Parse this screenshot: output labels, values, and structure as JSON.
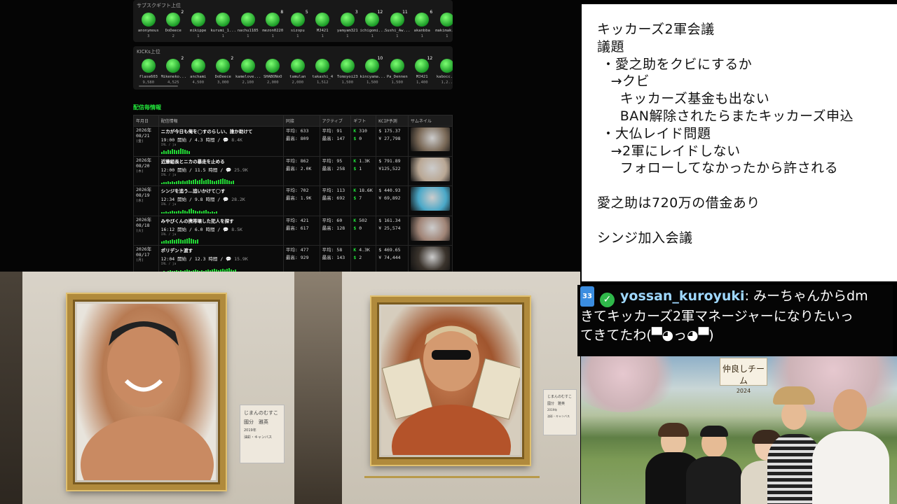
{
  "superchat_top": {
    "title": "サブスクギフト上位",
    "users": [
      {
        "name": "anonymous",
        "count": "3",
        "badge": "0"
      },
      {
        "name": "DoDeece",
        "count": "2",
        "badge": "2"
      },
      {
        "name": "mikippe",
        "count": "1",
        "badge": "0"
      },
      {
        "name": "kurumi_1...",
        "count": "1",
        "badge": "0"
      },
      {
        "name": "nachu1185",
        "count": "1",
        "badge": "0"
      },
      {
        "name": "mezon0220",
        "count": "1",
        "badge": "8"
      },
      {
        "name": "sizopu",
        "count": "1",
        "badge": "5"
      },
      {
        "name": "MJ421",
        "count": "1",
        "badge": "0"
      },
      {
        "name": "yamyam321",
        "count": "1",
        "badge": "3"
      },
      {
        "name": "ichigomi...",
        "count": "1",
        "badge": "12"
      },
      {
        "name": "Sushi_Aw...",
        "count": "1",
        "badge": "11"
      },
      {
        "name": "akanbba",
        "count": "1",
        "badge": "6"
      },
      {
        "name": "makimak...",
        "count": "1",
        "badge": "0"
      }
    ]
  },
  "kicks_top": {
    "title": "KICKs上位",
    "users": [
      {
        "name": "flase603",
        "count": "9,580",
        "badge": "0"
      },
      {
        "name": "Mikeneko...",
        "count": "4,525",
        "badge": "2"
      },
      {
        "name": "anchami",
        "count": "4,500",
        "badge": "0"
      },
      {
        "name": "DoDeece",
        "count": "3,000",
        "badge": "2"
      },
      {
        "name": "kamelove...",
        "count": "2,100",
        "badge": "0"
      },
      {
        "name": "SHABONoO",
        "count": "2,000",
        "badge": "0"
      },
      {
        "name": "tamulan",
        "count": "2,000",
        "badge": "0"
      },
      {
        "name": "takashi_4",
        "count": "1,512",
        "badge": "0"
      },
      {
        "name": "Tomoyoi23",
        "count": "1,500",
        "badge": "0"
      },
      {
        "name": "kincyama...",
        "count": "1,500",
        "badge": "10"
      },
      {
        "name": "Pa_Dennen",
        "count": "1,500",
        "badge": "0"
      },
      {
        "name": "MJ421",
        "count": "1,400",
        "badge": "12"
      },
      {
        "name": "kabocc...",
        "count": "1,2..",
        "badge": "0"
      }
    ]
  },
  "streams": {
    "section_title": "配信毎情報",
    "headers": [
      "年月日",
      "配信情報",
      "同接",
      "アクティブ",
      "ギフト",
      "KCIP予測",
      "サムネイル"
    ],
    "avg_label": "平均:",
    "max_label": "最高:",
    "rows": [
      {
        "year": "2026年",
        "md": "08/21",
        "wd": "(金)",
        "title": "ニカが今日も俺を◯すのらしい、誰か助けて",
        "start": "19:00 開始 / 4.3 時間",
        "chat": "8.4K",
        "sub": "IRL / ja",
        "viewers_avg": "633",
        "viewers_max": "809",
        "active_avg": "91",
        "active_max": "147",
        "gift_k": "310",
        "gift_s": "0",
        "kcip_usd": "$ 175.37",
        "kcip_jpy": "¥ 27,798",
        "thumb_color": "#7b6a58",
        "spark": [
          3,
          5,
          4,
          6,
          5,
          7,
          6,
          5,
          6,
          8,
          7,
          6,
          5,
          4
        ]
      },
      {
        "year": "2026年",
        "md": "08/20",
        "wd": "(木)",
        "title": "近藤組長とニカの暴走を止める",
        "start": "12:00 開始 / 11.5 時間",
        "chat": "25.9K",
        "sub": "IRL / ja",
        "viewers_avg": "862",
        "viewers_max": "2.0K",
        "active_avg": "95",
        "active_max": "258",
        "gift_k": "1.3K",
        "gift_s": "1",
        "kcip_usd": "$ 791.89",
        "kcip_jpy": "¥125,522",
        "thumb_color": "#b9a794",
        "spark": [
          2,
          3,
          3,
          4,
          3,
          4,
          3,
          4,
          5,
          4,
          5,
          4,
          5,
          6,
          5,
          6,
          7,
          5,
          6,
          8,
          5,
          6,
          7,
          6,
          5,
          4,
          5,
          6,
          7,
          8,
          7,
          6,
          5,
          4,
          5
        ]
      },
      {
        "year": "2026年",
        "md": "08/19",
        "wd": "(水)",
        "title": "シンジを追う…追いかけて◯す",
        "start": "12:34 開始 / 9.8 時間",
        "chat": "28.2K",
        "sub": "IRL / ja",
        "viewers_avg": "702",
        "viewers_max": "1.9K",
        "active_avg": "113",
        "active_max": "692",
        "gift_k": "18.6K",
        "gift_s": "7",
        "kcip_usd": "$ 440.93",
        "kcip_jpy": "¥ 69,892",
        "thumb_color": "#4aa8c8",
        "spark": [
          2,
          2,
          3,
          2,
          3,
          4,
          3,
          3,
          4,
          3,
          5,
          4,
          3,
          6,
          7,
          5,
          4,
          3,
          4,
          3,
          4,
          5,
          3,
          2,
          3,
          2,
          3
        ]
      },
      {
        "year": "2026年",
        "md": "08/18",
        "wd": "(火)",
        "title": "みやびくんの携帯壊した犯人を探す",
        "start": "16:12 開始 / 6.0 時間",
        "chat": "8.5K",
        "sub": "IRL / ja",
        "viewers_avg": "421",
        "viewers_max": "617",
        "active_avg": "60",
        "active_max": "128",
        "gift_k": "502",
        "gift_s": "0",
        "kcip_usd": "$ 161.34",
        "kcip_jpy": "¥ 25,574",
        "thumb_color": "#a08476",
        "spark": [
          3,
          4,
          5,
          4,
          5,
          6,
          5,
          6,
          7,
          6,
          5,
          6,
          7,
          8,
          7,
          6,
          5,
          6
        ]
      },
      {
        "year": "2026年",
        "md": "08/17",
        "wd": "(月)",
        "title": "ポリデント渡す",
        "start": "12:04 開始 / 12.3 時間",
        "chat": "15.9K",
        "sub": "IRL / ja",
        "viewers_avg": "477",
        "viewers_max": "929",
        "active_avg": "58",
        "active_max": "143",
        "gift_k": "4.3K",
        "gift_s": "2",
        "kcip_usd": "$ 469.65",
        "kcip_jpy": "¥ 74,444",
        "thumb_color": "#3a332c",
        "spark": [
          2,
          3,
          2,
          3,
          4,
          3,
          3,
          4,
          3,
          4,
          3,
          4,
          5,
          4,
          3,
          4,
          5,
          4,
          3,
          4,
          3,
          4,
          5,
          4,
          5,
          6,
          5,
          4,
          5,
          6,
          5,
          6,
          7,
          5,
          4,
          5
        ]
      }
    ]
  },
  "gallery": {
    "plaque_left": {
      "line1": "じまんのむすこ",
      "line2": "國分　雅英",
      "line3": "2019年",
      "line4": "油彩・キャンバス"
    },
    "plaque_right": {
      "line1": "じまんのむすこ",
      "line2": "國分　雅英",
      "line3": "2019年",
      "line4": "油彩・キャンバス"
    }
  },
  "notes": {
    "lines": [
      "キッカーズ2軍会議",
      "議題",
      " ・愛之助をクビにするか",
      "   →クビ",
      "     キッカーズ基金も出ない",
      "     BAN解除されたらまたキッカーズ申込",
      " ・大仏レイド問題",
      "   →2軍にレイドしない",
      "     フォローしてなかったから許される",
      "",
      "愛之助は720万の借金あり",
      "",
      "シンジ加入会議"
    ]
  },
  "chat": {
    "sub_months": "33",
    "username": "yossan_kuroyuki",
    "message_part1": "みーちゃんからdm",
    "message_part2": "きてキッカーズ2軍マネージャーになりたいっ",
    "message_part3": "てきてたわ(▀◕っ◕▀)"
  },
  "photo": {
    "sign_line1": "仲良しチーム",
    "sign_line2": "2024"
  }
}
